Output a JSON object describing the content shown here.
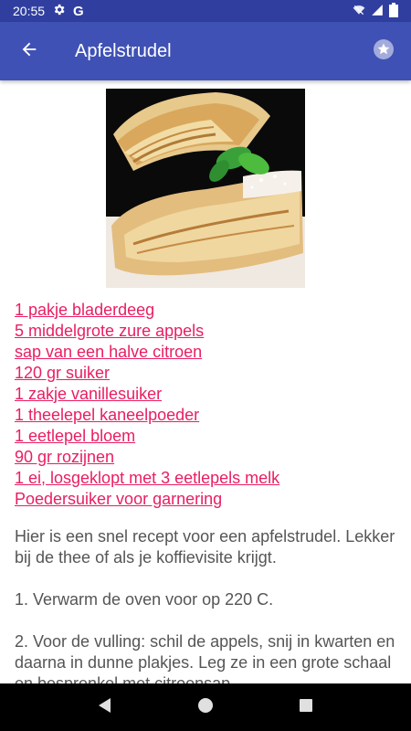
{
  "status_bar": {
    "time": "20:55",
    "icons": [
      "gear-icon",
      "google-icon",
      "wifi-icon",
      "signal-icon",
      "battery-icon"
    ]
  },
  "app_bar": {
    "title": "Apfelstrudel",
    "back_icon": "arrow-back-icon",
    "favorite_icon": "star-icon"
  },
  "recipe": {
    "image": "apfelstrudel-photo",
    "ingredients": [
      "1 pakje bladerdeeg",
      "5 middelgrote zure appels",
      "sap van een halve citroen",
      "120 gr suiker",
      "1 zakje vanillesuiker",
      "1 theelepel kaneelpoeder",
      "1 eetlepel bloem",
      "90 gr rozijnen",
      "1 ei, losgeklopt met 3 eetlepels melk",
      "Poedersuiker voor garnering"
    ],
    "paragraphs": [
      "Hier is een snel recept voor een apfelstrudel. Lekker bij de thee of als je koffievisite krijgt.",
      "1. Verwarm de oven voor op 220 C.",
      "2. Voor de vulling: schil de appels, snij in kwarten en daarna in dunne plakjes. Leg ze in een grote schaal en besprenkel met citroensap."
    ]
  },
  "colors": {
    "status_bar": "#303f9f",
    "app_bar": "#3f51b5",
    "link": "#e91e63",
    "body_text": "#555555"
  },
  "nav_bar": {
    "buttons": [
      "back-triangle-icon",
      "home-circle-icon",
      "recents-square-icon"
    ]
  }
}
